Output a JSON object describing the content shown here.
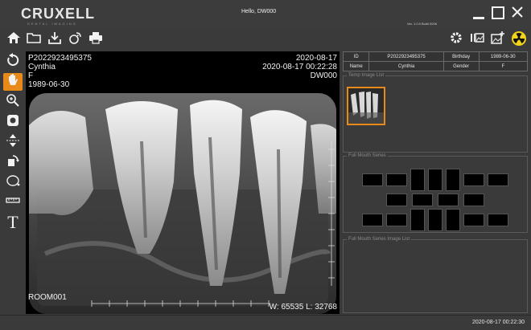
{
  "app": {
    "logo": "CRUXELL",
    "logo_sub": "DENTAL IMAGING",
    "greeting": "Hello, DW000",
    "version": "Ver. 1.0.0 Build 0006"
  },
  "window_controls": [
    "minimize-icon",
    "maximize-icon",
    "close-icon"
  ],
  "toolbar": {
    "left_icons": [
      "home-icon",
      "folder-icon",
      "download-icon",
      "satellite-icon",
      "print-icon"
    ],
    "right_icons": [
      "gear-icon",
      "barcode-icon",
      "add-image-icon",
      "radiation-icon"
    ]
  },
  "left_tools": [
    "rotate-icon",
    "hand-icon",
    "zoom-icon",
    "circle-icon",
    "flip-vertical-icon",
    "rotate-shape-icon",
    "ellipse-icon",
    "ruler-icon",
    "text-icon"
  ],
  "active_tool": "hand-icon",
  "overlay": {
    "patient_id": "P2022923495375",
    "name": "Cynthia",
    "sex": "F",
    "birthdate": "1989-06-30",
    "study_date": "2020-08-17",
    "study_datetime": "2020-08-17 00:22:28",
    "operator": "DW000",
    "room": "ROOM001",
    "window_level": "W: 65535 L: 32768"
  },
  "patient_info": {
    "rows": [
      [
        "ID",
        "P2022923495375",
        "Birthday",
        "1989-06-30"
      ],
      [
        "Name",
        "Cynthia",
        "Gender",
        "F"
      ]
    ]
  },
  "panels": {
    "temp_list_title": "Temp Image List",
    "full_mouth_title": "Full Mouth Series",
    "full_mouth_list_title": "Full Mouth Series Image List"
  },
  "status": {
    "clock": "2020-08-17 00:22:30"
  },
  "colors": {
    "accent": "#e88a1a",
    "background": "#3a3a3a",
    "radiation": "#f2d21a"
  }
}
